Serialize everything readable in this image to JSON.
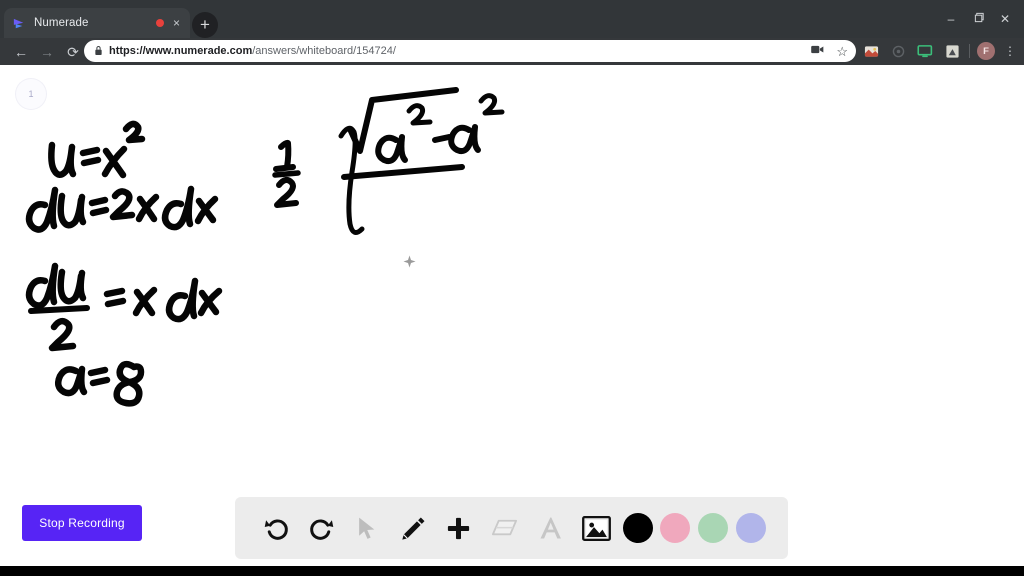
{
  "browser": {
    "tab": {
      "title": "Numerade",
      "favicon_icon": "numerade-play-logo-icon",
      "recording_indicator": "recording-dot-icon",
      "close_icon": "×"
    },
    "new_tab_label": "+",
    "window_controls": {
      "minimize": "–",
      "maximize": "❐",
      "close": "✕"
    },
    "nav": {
      "back": "←",
      "forward": "→",
      "reload": "⟳"
    },
    "omnibox": {
      "lock_icon": "🔒",
      "url_domain": "https://www.numerade.com",
      "url_path": "/answers/whiteboard/154724/",
      "media_icon": "camera-icon",
      "bookmark_icon": "☆"
    },
    "extensions": [
      {
        "name": "extension-colorful-icon"
      },
      {
        "name": "extension-circle-icon"
      },
      {
        "name": "cast-screen-icon"
      },
      {
        "name": "extension-square-icon"
      }
    ],
    "profile": {
      "initial": "F"
    },
    "menu_icon": "⋮"
  },
  "whiteboard": {
    "page_number": "1",
    "handwriting_left": [
      "u = x²",
      "du = 2x dx",
      "du/2 = x dx",
      "a = 8"
    ],
    "handwriting_right": "1/2 ∫ √(a² - a²)",
    "cursor": "crosshair-cursor-icon"
  },
  "footer": {
    "stop_recording_label": "Stop Recording",
    "stop_recording_color": "#5724f5",
    "tools": [
      {
        "name": "undo-tool",
        "label": "Undo",
        "state": "enabled"
      },
      {
        "name": "redo-tool",
        "label": "Redo",
        "state": "enabled"
      },
      {
        "name": "select-tool",
        "label": "Select",
        "state": "disabled"
      },
      {
        "name": "pencil-tool",
        "label": "Pencil",
        "state": "active"
      },
      {
        "name": "add-tool",
        "label": "Add",
        "state": "enabled"
      },
      {
        "name": "eraser-tool",
        "label": "Eraser",
        "state": "disabled"
      },
      {
        "name": "text-tool",
        "label": "Text",
        "state": "disabled"
      },
      {
        "name": "image-tool",
        "label": "Image",
        "state": "enabled"
      }
    ],
    "colors": [
      {
        "name": "color-black",
        "hex": "#000000",
        "selected": true
      },
      {
        "name": "color-pink",
        "hex": "#f0a8bd",
        "selected": false
      },
      {
        "name": "color-green",
        "hex": "#a9d6b4",
        "selected": false
      },
      {
        "name": "color-periwinkle",
        "hex": "#b1b5ea",
        "selected": false
      }
    ]
  }
}
